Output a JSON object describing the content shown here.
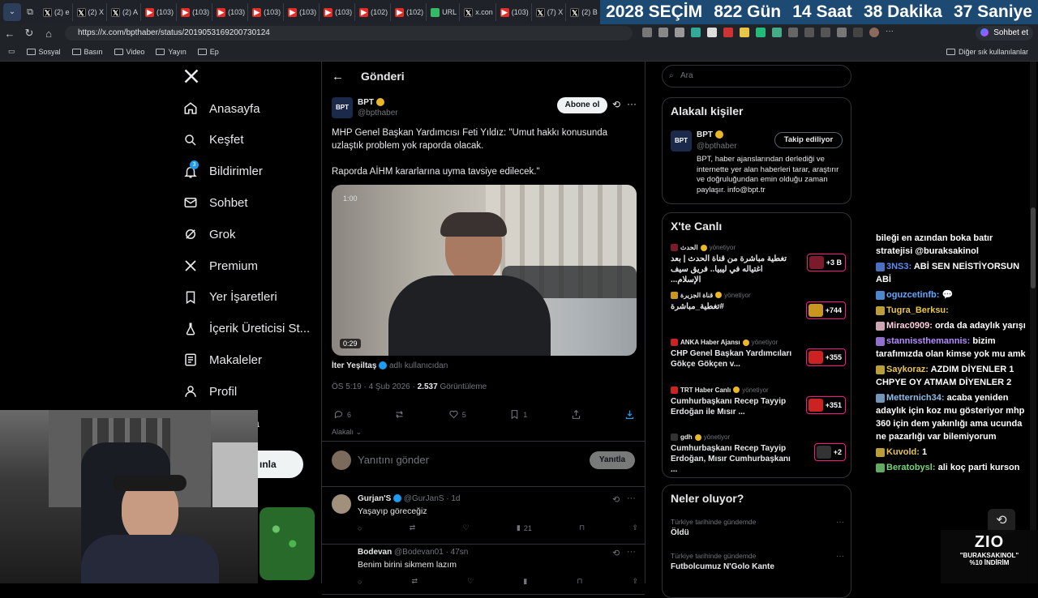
{
  "browser": {
    "tabs": [
      {
        "icon": "x",
        "label": "(2) e"
      },
      {
        "icon": "x",
        "label": "(2) X"
      },
      {
        "icon": "x",
        "label": "(2) A"
      },
      {
        "icon": "yt",
        "label": "(103)"
      },
      {
        "icon": "yt",
        "label": "(103)"
      },
      {
        "icon": "yt",
        "label": "(103)"
      },
      {
        "icon": "yt",
        "label": "(103)"
      },
      {
        "icon": "yt",
        "label": "(103)"
      },
      {
        "icon": "yt",
        "label": "(103)"
      },
      {
        "icon": "yt",
        "label": "(102)"
      },
      {
        "icon": "yt",
        "label": "(102)"
      },
      {
        "icon": "g",
        "label": "URL"
      },
      {
        "icon": "x",
        "label": "x.con"
      },
      {
        "icon": "yt",
        "label": "(103)"
      },
      {
        "icon": "x",
        "label": "(7) X"
      },
      {
        "icon": "x",
        "label": "(2) B"
      },
      {
        "icon": "yt",
        "label": "(103)"
      }
    ],
    "countdown": {
      "year_label": "2028 SEÇİM",
      "days": "822 Gün",
      "hours": "14 Saat",
      "minutes": "38 Dakika",
      "seconds": "37 Saniye"
    },
    "url": "https://x.com/bpthaber/status/2019053169200730124",
    "profile_label": "Sohbet et",
    "bookmarks": [
      "Sosyal",
      "Basın",
      "Video",
      "Yayın",
      "Ep"
    ],
    "other_bookmarks": "Diğer sık kullanılanlar"
  },
  "sidebar": {
    "items": [
      {
        "label": "Anasayfa",
        "icon": "home-icon"
      },
      {
        "label": "Keşfet",
        "icon": "search-icon"
      },
      {
        "label": "Bildirimler",
        "icon": "bell-icon",
        "badge": "3"
      },
      {
        "label": "Sohbet",
        "icon": "mail-icon"
      },
      {
        "label": "Grok",
        "icon": "grok-icon"
      },
      {
        "label": "Premium",
        "icon": "x-icon"
      },
      {
        "label": "Yer İşaretleri",
        "icon": "bookmark-icon"
      },
      {
        "label": "İçerik Üreticisi St...",
        "icon": "flask-icon"
      },
      {
        "label": "Makaleler",
        "icon": "article-icon"
      },
      {
        "label": "Profil",
        "icon": "person-icon"
      }
    ],
    "post_button_fragment": "ınla",
    "more_fragment": "a"
  },
  "post": {
    "header_title": "Gönderi",
    "author_name": "BPT",
    "author_handle": "@bpthaber",
    "avatar_text": "BPT",
    "subscribe_label": "Abone ol",
    "text_line1": "MHP Genel Başkan Yardımcısı Feti Yıldız: \"Umut hakkı konusunda",
    "text_line2": "uzlaştık problem yok raporda olacak.",
    "text_line3": "Raporda AİHM kararlarına uyma tavsiye edilecek.\"",
    "video_time_top": "1:00",
    "video_duration": "0:29",
    "tagged_user": "İter Yeşiltaş",
    "tagged_note": "adlı kullanıcıdan",
    "meta_time": "ÖS 5:19 · 4 Şub 2026 ·",
    "views": "2.537",
    "views_label": "Görüntüleme",
    "reply_count": "6",
    "like_count": "5",
    "bookmark_count": "1",
    "relevant_label": "Alakalı",
    "reply_placeholder": "Yanıtını gönder",
    "reply_button": "Yanıtla"
  },
  "replies": [
    {
      "name": "Gurjan'S",
      "handle": "@GurJanS",
      "time": "· 1d",
      "text": "Yaşayıp göreceğiz",
      "views": "21"
    },
    {
      "name": "Bodevan",
      "handle": "@Bodevan01",
      "time": "· 47sn",
      "text": "Benim birini sikmem lazım"
    }
  ],
  "right": {
    "search_placeholder": "Ara",
    "related_title": "Alakalı kişiler",
    "related_name": "BPT",
    "related_handle": "@bpthaber",
    "follow_label": "Takip ediliyor",
    "related_bio": "BPT, haber ajanslarından derlediği ve internette yer alan haberleri tarar, araştırır ve doğruluğundan emin olduğu zaman paylaşır. info@bpt.tr",
    "live_title": "X'te Canlı",
    "live": [
      {
        "source": "الحدث",
        "host": "yönetiyor",
        "title": "تغطية مباشرة من قناة الحدث | بعد اغتياله في ليبيا.. فريق سيف الإسلام...",
        "count": "+3 B",
        "color": "#7a1a2a"
      },
      {
        "source": "قناة الجزيرة",
        "host": "yönetiyor",
        "title": "#تغطية_مباشرة",
        "count": "+744",
        "color": "#c8961e"
      },
      {
        "source": "ANKA Haber Ajansı",
        "host": "yönetiyor",
        "title": "CHP Genel Başkan Yardımcıları Gökçe Gökçen v...",
        "count": "+355",
        "color": "#c22"
      },
      {
        "source": "TRT Haber Canlı",
        "host": "yönetiyor",
        "title": "Cumhurbaşkanı Recep Tayyip Erdoğan ile Mısır ...",
        "count": "+351",
        "color": "#c22"
      },
      {
        "source": "gdh",
        "host": "yönetiyor",
        "title": "Cumhurbaşkanı Recep Tayyip Erdoğan, Mısır Cumhurbaşkanı ...",
        "count": "+2",
        "color": "#333"
      }
    ],
    "trends_title": "Neler oluyor?",
    "trends": [
      {
        "context": "Türkiye tarihinde gündemde",
        "name": "Öldü"
      },
      {
        "context": "Türkiye tarihinde gündemde",
        "name": "Futbolcumuz N'Golo Kante"
      }
    ]
  },
  "chat": [
    {
      "user": "",
      "msg": "bileği en azından boka batır stratejisi @buraksakinol",
      "color": "#ffffff"
    },
    {
      "user": "3NS3:",
      "msg": "ABİ SEN NEİSTİYORSUN ABİ",
      "color": "#5b8def"
    },
    {
      "user": "oguzcetinfb:",
      "msg": "💬",
      "color": "#5fa8ff"
    },
    {
      "user": "Tugra_Berksu:",
      "msg": "",
      "color": "#e8c547"
    },
    {
      "user": "Mirac0909:",
      "msg": "orda da adaylık yarışı",
      "color": "#ffd0e0"
    },
    {
      "user": "stannissthemannis:",
      "msg": "bizim tarafımızda olan kimse yok mu amk",
      "color": "#b48cff"
    },
    {
      "user": "Saykoraz:",
      "msg": "AZDIM DİYENLER 1 CHPYE OY ATMAM DİYENLER 2",
      "color": "#e8c547"
    },
    {
      "user": "Metternich34:",
      "msg": "acaba yeniden adaylık için koz mu gösteriyor mhp 360 için dem yakınlığı ama ucunda ne pazarlığı var bilemiyorum",
      "color": "#8fbce8"
    },
    {
      "user": "Kuvold:",
      "msg": "1",
      "color": "#e8c547"
    },
    {
      "user": "Beratobysl:",
      "msg": "ali koç parti kurson",
      "color": "#7bd37b"
    }
  ],
  "overlay": {
    "logo": "ZIO",
    "promo_line1": "\"BURAKSAKINOL\"",
    "promo_line2": "%10 İNDİRİM"
  }
}
